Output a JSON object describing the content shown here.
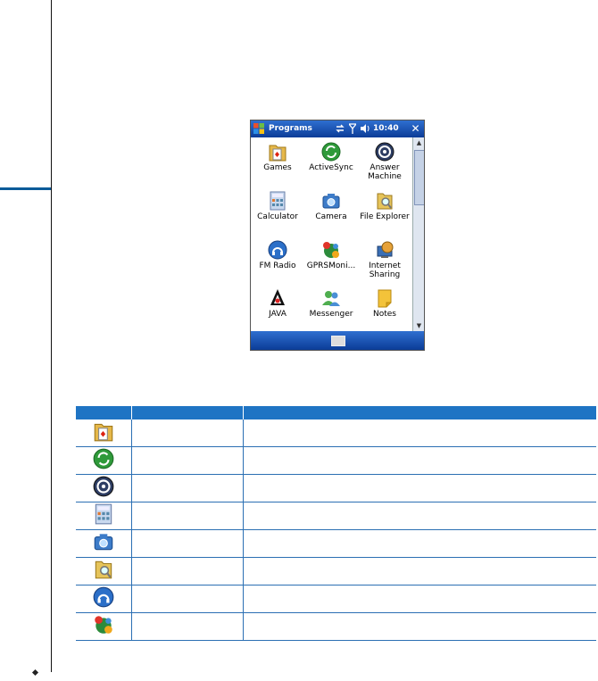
{
  "device": {
    "title": "Programs",
    "time": "10:40",
    "apps": [
      {
        "label": "Games",
        "icon": "games-icon"
      },
      {
        "label": "ActiveSync",
        "icon": "activesync-icon"
      },
      {
        "label": "Answer Machine",
        "icon": "answer-machine-icon"
      },
      {
        "label": "Calculator",
        "icon": "calculator-icon"
      },
      {
        "label": "Camera",
        "icon": "camera-icon"
      },
      {
        "label": "File Explorer",
        "icon": "file-explorer-icon"
      },
      {
        "label": "FM Radio",
        "icon": "fm-radio-icon"
      },
      {
        "label": "GPRSMoni...",
        "icon": "gprs-monitor-icon"
      },
      {
        "label": "Internet Sharing",
        "icon": "internet-sharing-icon"
      },
      {
        "label": "JAVA",
        "icon": "java-icon"
      },
      {
        "label": "Messenger",
        "icon": "messenger-icon"
      },
      {
        "label": "Notes",
        "icon": "notes-icon"
      }
    ]
  },
  "table": {
    "header": [
      "",
      "",
      ""
    ],
    "rows": [
      {
        "icon": "games-icon"
      },
      {
        "icon": "activesync-icon"
      },
      {
        "icon": "answer-machine-icon"
      },
      {
        "icon": "calculator-icon"
      },
      {
        "icon": "camera-icon"
      },
      {
        "icon": "file-explorer-icon"
      },
      {
        "icon": "fm-radio-icon"
      },
      {
        "icon": "gprs-monitor-icon"
      }
    ]
  },
  "colors": {
    "accent": "#1f74c4",
    "titlebar": "#0b3c97"
  }
}
